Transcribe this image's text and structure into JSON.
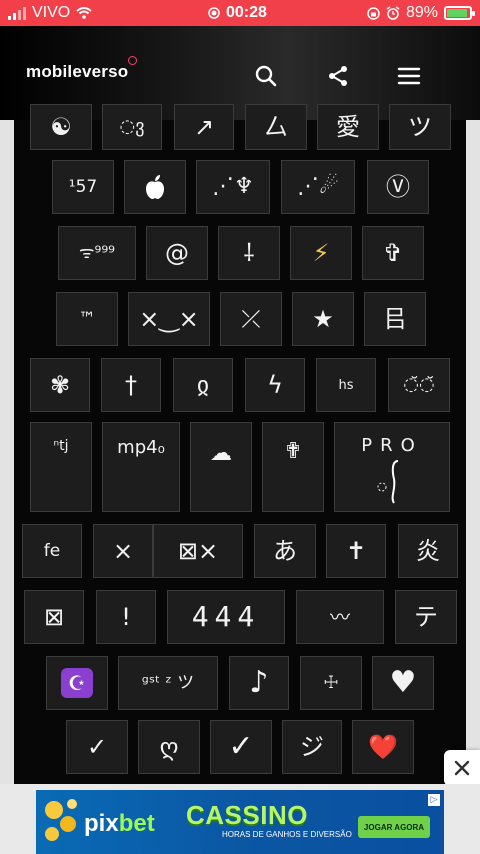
{
  "status_bar": {
    "carrier": "VIVO",
    "time": "00:28",
    "battery_percent": "89%",
    "battery_level": 0.89
  },
  "header": {
    "logo_text": "mobileverso",
    "icons": [
      "search-icon",
      "share-icon",
      "menu-icon"
    ]
  },
  "keys": [
    {
      "name": "key-yinyang",
      "label": "☯"
    },
    {
      "name": "key-circle-glyph",
      "label": "◌ვ"
    },
    {
      "name": "key-arrow-glyph",
      "label": "↗"
    },
    {
      "name": "key-kanji-ko",
      "label": "厶"
    },
    {
      "name": "key-kanji-love",
      "label": "愛"
    },
    {
      "name": "key-katakana-tsu-1",
      "label": "ツ"
    },
    {
      "name": "key-157",
      "label": "¹57"
    },
    {
      "name": "key-apple",
      "label": ""
    },
    {
      "name": "key-swirl-1",
      "label": "⋰♆"
    },
    {
      "name": "key-swirl-2",
      "label": "⋰☄"
    },
    {
      "name": "key-circled-v",
      "label": "Ⓥ"
    },
    {
      "name": "key-wifi-999",
      "label": "ᯤ⁹⁹⁹"
    },
    {
      "name": "key-at",
      "label": "@"
    },
    {
      "name": "key-sparkle-cross",
      "label": "⸸"
    },
    {
      "name": "key-lightning",
      "label": "⚡"
    },
    {
      "name": "key-latin-cross-1",
      "label": "✞"
    },
    {
      "name": "key-tm",
      "label": "™"
    },
    {
      "name": "key-face-xx",
      "label": "×‿×"
    },
    {
      "name": "key-check-x",
      "label": "⤫"
    },
    {
      "name": "key-star",
      "label": "★"
    },
    {
      "name": "key-kanji-sho",
      "label": "㠯"
    },
    {
      "name": "key-flower",
      "label": "✾"
    },
    {
      "name": "key-dagger",
      "label": "†"
    },
    {
      "name": "key-georgian-glyph",
      "label": "ჲ"
    },
    {
      "name": "key-squiggle",
      "label": "ϟ"
    },
    {
      "name": "key-hs",
      "label": "hs"
    },
    {
      "name": "key-eyes",
      "label": "◌̆◌̆"
    },
    {
      "name": "key-ntj",
      "label": "ⁿtj"
    },
    {
      "name": "key-mp40",
      "label": "mp4₀"
    },
    {
      "name": "key-cloud",
      "label": "☁"
    },
    {
      "name": "key-latin-cross-2",
      "label": "✟"
    },
    {
      "name": "key-pro",
      "label": "PRO"
    },
    {
      "name": "key-fe",
      "label": "fe"
    },
    {
      "name": "key-multiply",
      "label": "×"
    },
    {
      "name": "key-box-x",
      "label": "⊠×"
    },
    {
      "name": "key-hiragana-a",
      "label": "あ"
    },
    {
      "name": "key-cross-small",
      "label": "✝"
    },
    {
      "name": "key-kanji-fire",
      "label": "炎"
    },
    {
      "name": "key-box-x-2",
      "label": "⊠"
    },
    {
      "name": "key-exclaim",
      "label": "!"
    },
    {
      "name": "key-444",
      "label": "444"
    },
    {
      "name": "key-wing-eye",
      "label": "〰"
    },
    {
      "name": "key-katakana-te",
      "label": "テ"
    },
    {
      "name": "key-star-crescent",
      "label": "☪"
    },
    {
      "name": "key-gstz-tsu",
      "label": "ᵍˢᵗ ᶻ ツ"
    },
    {
      "name": "key-music-note",
      "label": "♪"
    },
    {
      "name": "key-orthodox-cross",
      "label": "☩"
    },
    {
      "name": "key-heart-white",
      "label": "♥"
    },
    {
      "name": "key-check-1",
      "label": "✓"
    },
    {
      "name": "key-heart-glyph",
      "label": "ღ"
    },
    {
      "name": "key-check-2",
      "label": "✓"
    },
    {
      "name": "key-katakana-ji",
      "label": "ジ"
    },
    {
      "name": "key-heart-red",
      "label": "❤️"
    }
  ],
  "ad": {
    "brand_prefix": "pix",
    "brand_suffix": "bet",
    "title": "CASSINO",
    "subtitle": "HORAS DE GANHOS E DIVERSÃO",
    "cta": "JOGAR AGORA",
    "info_icon": "info-icon"
  },
  "colors": {
    "status_bar": "#f1404a",
    "key_bg": "#1d1d1d",
    "content_bg": "#070707",
    "ad_bg": "#0b57a4"
  }
}
